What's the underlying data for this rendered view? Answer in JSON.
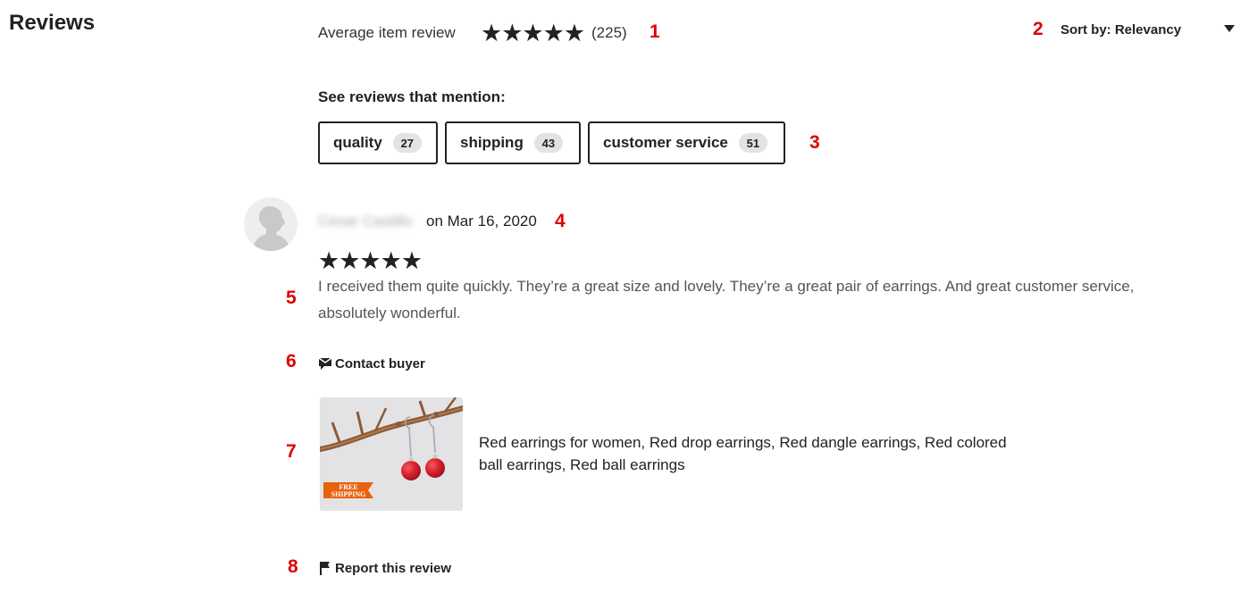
{
  "section": {
    "title": "Reviews"
  },
  "summary": {
    "label": "Average item review",
    "stars": "★★★★★",
    "rating": 5,
    "count": "(225)"
  },
  "sort": {
    "label": "Sort by: Relevancy"
  },
  "mentions": {
    "title": "See reviews that mention:",
    "chips": [
      {
        "label": "quality",
        "count": "27"
      },
      {
        "label": "shipping",
        "count": "43"
      },
      {
        "label": "customer service",
        "count": "51"
      }
    ]
  },
  "review": {
    "reviewer_name": "Cesar Castillo",
    "date": "on Mar 16, 2020",
    "stars": "★★★★★",
    "rating": 5,
    "text": "I received them quite quickly. They’re a great size and lovely. They’re a great pair of earrings. And great customer service, absolutely wonderful.",
    "contact_label": "Contact buyer",
    "product": {
      "badge_line1": "FREE",
      "badge_line2": "SHIPPING",
      "title": "Red earrings for women, Red drop earrings, Red dangle earrings, Red colored ball earrings, Red ball earrings"
    },
    "report_label": "Report this review"
  },
  "markers": [
    "1",
    "2",
    "3",
    "4",
    "5",
    "6",
    "7",
    "8"
  ],
  "colors": {
    "text": "#222222",
    "muted": "#555555",
    "marker": "#e00000",
    "chip_count_bg": "#e3e3e3",
    "badge": "#e8620d",
    "bead": "#d8202c"
  }
}
